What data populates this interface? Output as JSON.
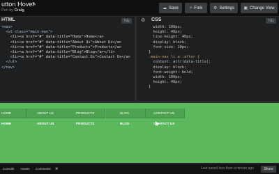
{
  "header": {
    "title": "utton Hover",
    "byline_prefix": "Pen by",
    "author": "Craig",
    "buttons": {
      "save": "Save",
      "fork": "Fork",
      "settings": "Settings",
      "change_view": "Change View"
    }
  },
  "html_pane": {
    "title": "HTML",
    "tidy": "Tidy",
    "lines": [
      "<nav>",
      "  <ul class=\"main-nav\">",
      "    <li><a href=\"#\" data-title=\"Home\">Home</a>",
      "    <li><a href=\"#\" data-title=\"About Us\">About Us</a>",
      "    <li><a href=\"#\" data-title=\"Products\">Products</a>",
      "    <li><a href=\"#\" data-title=\"Blog\">Blog</a></li>",
      "    <li><a href=\"#\" data-title=\"Contact Us\">Contact Us</a>",
      "  </ul>",
      "</nav>"
    ]
  },
  "css_pane": {
    "title": "CSS",
    "tidy": "Tidy",
    "lines": [
      "  width: 100px;",
      "  height: 40px;",
      "  line-height: 40px;",
      "  display: block;",
      "  font-size: 10px;",
      "}",
      "",
      ".main-nav li a::after {",
      "  content: attr(data-title);",
      "  display: block;",
      "  font-weight: bold;",
      "  width: 100px;",
      "  height: 40px;",
      "}"
    ]
  },
  "result": {
    "nav_row1": [
      "HOME",
      "ABOUT US",
      "PRODUCTS",
      "BLOG",
      "CONTACT US"
    ],
    "nav_row2": [
      "HOME",
      "ABOUT US",
      "PRODUCTS",
      "BLOG",
      "CONTACT US"
    ],
    "background_color": "#5bb85d"
  },
  "statusbar": {
    "tabs": [
      "Console",
      "Assets",
      "Comments",
      "⌘"
    ],
    "saved_text": "Last saved less than a minute ago",
    "share_label": "Share"
  }
}
